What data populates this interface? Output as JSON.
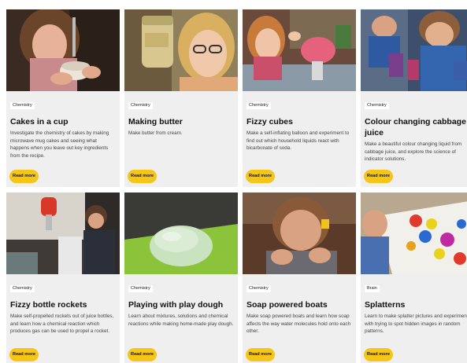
{
  "colors": {
    "accent": "#f5c518",
    "card_bg": "#efefef"
  },
  "cards": [
    {
      "tag": "Chemistry",
      "title": "Cakes in a cup",
      "description": "Investigate the chemistry of cakes by making microwave mug cakes and seeing what happens when you leave out key ingredients from the recipe.",
      "button": "Read more"
    },
    {
      "tag": "Chemistry",
      "title": "Making butter",
      "description": "Make butter from cream.",
      "button": "Read more"
    },
    {
      "tag": "Chemistry",
      "title": "Fizzy cubes",
      "description": "Make a self-inflating balloon and experiment to find out which household liquids react with bicarbonate of soda.",
      "button": "Read more"
    },
    {
      "tag": "Chemistry",
      "title": "Colour changing cabbage juice",
      "description": "Make a beautiful colour changing liquid from cabbage juice, and explore the science of indicator solutions.",
      "button": "Read more"
    },
    {
      "tag": "Chemistry",
      "title": "Fizzy bottle rockets",
      "description": "Make self-propelled rockets out of juice bottles, and learn how a chemical reaction which produces gas can be used to propel a rocket.",
      "button": "Read more"
    },
    {
      "tag": "Chemistry",
      "title": "Playing with play dough",
      "description": "Learn about mixtures, solutions and chemical reactions while making home-made play dough.",
      "button": "Read more"
    },
    {
      "tag": "Chemistry",
      "title": "Soap powered boats",
      "description": "Make soap powered boats and learn how soap affects the way water molecules hold onto each other.",
      "button": "Read more"
    },
    {
      "tag": "Brain",
      "title": "Splatterns",
      "description": "Learn to make splatter pictures and experiment with trying to spot hidden images in random patterns.",
      "button": "Read more"
    }
  ]
}
